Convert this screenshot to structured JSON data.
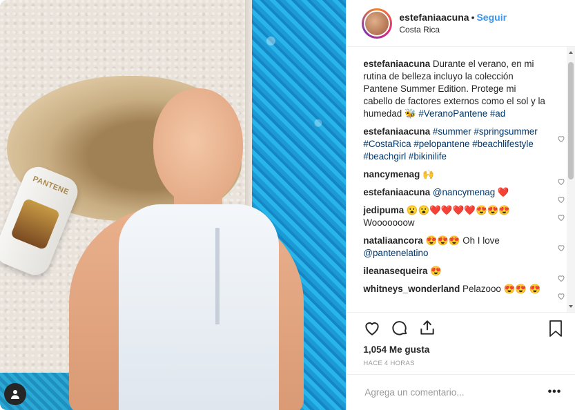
{
  "header": {
    "username": "estefaniaacuna",
    "separator": "•",
    "follow_label": "Seguir",
    "location": "Costa Rica"
  },
  "photo": {
    "bottle_brand": "PANTENE"
  },
  "comments": [
    {
      "user": "estefaniaacuna",
      "text": "Durante el verano, en mi rutina de belleza incluyo la colección Pantene Summer Edition. Protege mi cabello de factores externos como el sol y la humedad 🐝",
      "tags": "#VeranoPantene #ad",
      "heart": false
    },
    {
      "user": "estefaniaacuna",
      "text": "",
      "tags": "#summer #springsummer #CostaRica #pelopantene #beachlifestyle #beachgirl #bikinilife",
      "heart": true
    },
    {
      "user": "nancymenag",
      "text": "🙌",
      "tags": "",
      "heart": true
    },
    {
      "user": "estefaniaacuna",
      "text": "",
      "tags": "@nancymenag ❤️",
      "heart": true
    },
    {
      "user": "jedipuma",
      "text": "😮😮❤️❤️❤️❤️😍😍😍 Wooooooow",
      "tags": "",
      "heart": true
    },
    {
      "user": "nataliaancora",
      "text": "😍😍😍 Oh I love",
      "tags": "@pantenelatino",
      "heart": true
    },
    {
      "user": "ileanasequeira",
      "text": "😍",
      "tags": "",
      "heart": true
    },
    {
      "user": "whitneys_wonderland",
      "text": "Pelazooo 😍😍 😍",
      "tags": "",
      "heart": true
    }
  ],
  "actions": {
    "likes": "1,054 Me gusta",
    "time": "HACE 4 HORAS"
  },
  "add_comment": {
    "placeholder": "Agrega un comentario...",
    "more": "•••"
  }
}
